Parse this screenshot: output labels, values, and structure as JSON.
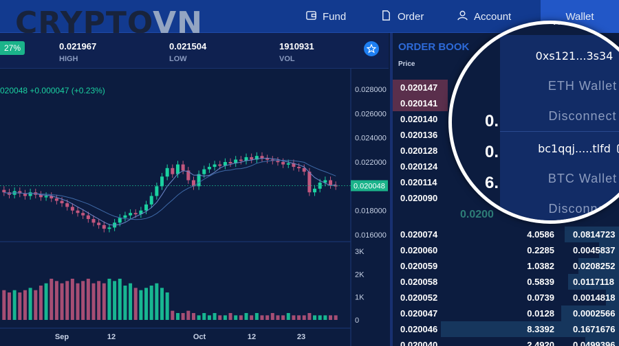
{
  "logo": {
    "part1": "CRYPTO",
    "part2": "VN"
  },
  "nav": {
    "fund": "Fund",
    "order": "Order",
    "account": "Account",
    "wallet": "Wallet"
  },
  "stats": {
    "change_pct": "27%",
    "high_value": "0.021967",
    "high_label": "HIGH",
    "low_value": "0.021504",
    "low_label": "LOW",
    "vol_value": "1910931",
    "vol_label": "VOL"
  },
  "chart": {
    "price_change": "020048  +0.000047 (+0.23%)",
    "current_price_tag": "0.020048"
  },
  "chart_data": {
    "type": "candlestick",
    "price_ticks": [
      "0.028000",
      "0.026000",
      "0.024000",
      "0.022000",
      "0.020000",
      "0.018000",
      "0.016000"
    ],
    "volume_ticks": [
      "3K",
      "2K",
      "1K",
      "0"
    ],
    "x_ticks": [
      "Sep",
      "12",
      "Oct",
      "12",
      "23"
    ],
    "closes": [
      0.0195,
      0.0193,
      0.0196,
      0.0194,
      0.0192,
      0.0195,
      0.0193,
      0.0191,
      0.0192,
      0.019,
      0.0188,
      0.0186,
      0.0183,
      0.018,
      0.0178,
      0.0176,
      0.0173,
      0.017,
      0.0168,
      0.0165,
      0.0166,
      0.017,
      0.0174,
      0.0176,
      0.0178,
      0.0177,
      0.018,
      0.0185,
      0.0192,
      0.02,
      0.0208,
      0.0215,
      0.021,
      0.0218,
      0.0213,
      0.0205,
      0.02,
      0.021,
      0.0214,
      0.0216,
      0.0218,
      0.0217,
      0.022,
      0.0219,
      0.0222,
      0.0221,
      0.0224,
      0.0222,
      0.0225,
      0.0223,
      0.0222,
      0.0221,
      0.022,
      0.0218,
      0.0219,
      0.0216,
      0.0215,
      0.0212,
      0.0195,
      0.0198,
      0.0203,
      0.0205,
      0.0201,
      0.02
    ],
    "volumes": [
      1.3,
      1.2,
      1.3,
      1.2,
      1.3,
      1.4,
      1.3,
      1.5,
      1.6,
      1.8,
      1.7,
      1.6,
      1.7,
      1.8,
      1.6,
      1.7,
      1.8,
      1.6,
      1.7,
      1.6,
      1.8,
      1.7,
      1.8,
      1.5,
      1.6,
      1.4,
      1.3,
      1.4,
      1.5,
      1.6,
      1.4,
      1.2,
      0.4,
      0.3,
      0.3,
      0.4,
      0.3,
      0.2,
      0.3,
      0.2,
      0.3,
      0.2,
      0.2,
      0.3,
      0.2,
      0.2,
      0.3,
      0.2,
      0.3,
      0.2,
      0.2,
      0.3,
      0.2,
      0.2,
      0.3,
      0.2,
      0.2,
      0.2,
      0.3,
      0.2,
      0.2,
      0.2,
      0.2,
      0.2
    ]
  },
  "orderbook": {
    "title": "ORDER BOOK",
    "price_header": "Price",
    "asks": [
      {
        "price": "0.020147",
        "amount": "",
        "total": ""
      },
      {
        "price": "0.020141",
        "amount": "",
        "total": ""
      },
      {
        "price": "0.020140",
        "amount": "",
        "total": ""
      },
      {
        "price": "0.020136",
        "amount": "",
        "total": ""
      },
      {
        "price": "0.020128",
        "amount": "",
        "total": ""
      },
      {
        "price": "0.020124",
        "amount": "",
        "total": ""
      },
      {
        "price": "0.020114",
        "amount": "",
        "total": ""
      },
      {
        "price": "0.020090",
        "amount": "",
        "total": ""
      }
    ],
    "mid_price": "0.0200",
    "bids": [
      {
        "price": "0.020074",
        "amount": "4.0586",
        "total": "0.0814723"
      },
      {
        "price": "0.020060",
        "amount": "0.2285",
        "total": "0.0045837"
      },
      {
        "price": "0.020059",
        "amount": "1.0382",
        "total": "0.0208252"
      },
      {
        "price": "0.020058",
        "amount": "0.5839",
        "total": "0.0117118"
      },
      {
        "price": "0.020052",
        "amount": "0.0739",
        "total": "0.0014818"
      },
      {
        "price": "0.020047",
        "amount": "0.0128",
        "total": "0.0002566"
      },
      {
        "price": "0.020046",
        "amount": "8.3392",
        "total": "0.1671676"
      },
      {
        "price": "0.020040",
        "amount": "2.4920",
        "total": "0.0499396"
      }
    ]
  },
  "wallet_dropdown": {
    "eth_address": "0xs121...3s34",
    "eth_label": "ETH Wallet",
    "eth_disconnect": "Disconnect",
    "btc_address": "bc1qqj.....tlfd",
    "btc_label": "BTC Wallet",
    "btc_disconnect": "Disconnect"
  },
  "colors": {
    "nav_bg": "#123a8f",
    "up": "#1bd1a0",
    "down": "#c2577e",
    "ask_bar": "#5a2f4c",
    "bid_bar": "#16365d"
  }
}
